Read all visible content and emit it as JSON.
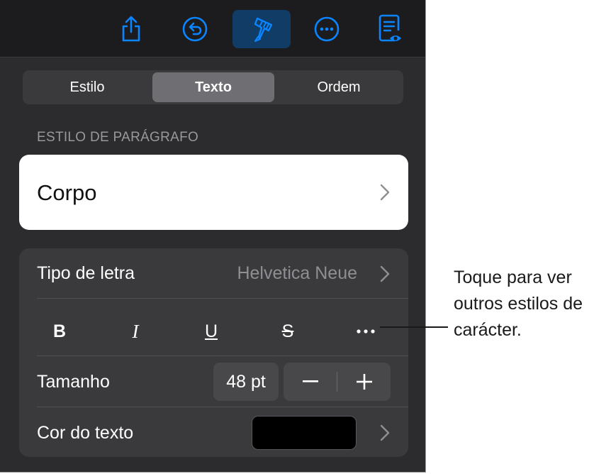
{
  "colors": {
    "accent": "#0a84ff",
    "active_bg": "#103c66",
    "panel_bg": "#2c2c2e"
  },
  "toolbar": {
    "buttons": [
      {
        "icon": "share-icon"
      },
      {
        "icon": "undo-icon"
      },
      {
        "icon": "paintbrush-icon",
        "active": true
      },
      {
        "icon": "more-icon"
      },
      {
        "icon": "document-view-icon"
      }
    ]
  },
  "segment": {
    "tabs": [
      "Estilo",
      "Texto",
      "Ordem"
    ],
    "selected": "Texto"
  },
  "paragraph_style": {
    "section_label": "ESTILO DE PARÁGRAFO",
    "value": "Corpo"
  },
  "font": {
    "label": "Tipo de letra",
    "value": "Helvetica Neue"
  },
  "format": {
    "bold": "B",
    "italic": "I",
    "underline": "U",
    "strike": "S"
  },
  "size": {
    "label": "Tamanho",
    "value": "48 pt",
    "decrement": "−",
    "increment": "+"
  },
  "text_color": {
    "label": "Cor do texto",
    "swatch_color": "#000000"
  },
  "callout": {
    "lines": [
      "Toque para ver",
      "outros estilos de",
      "carácter."
    ]
  }
}
